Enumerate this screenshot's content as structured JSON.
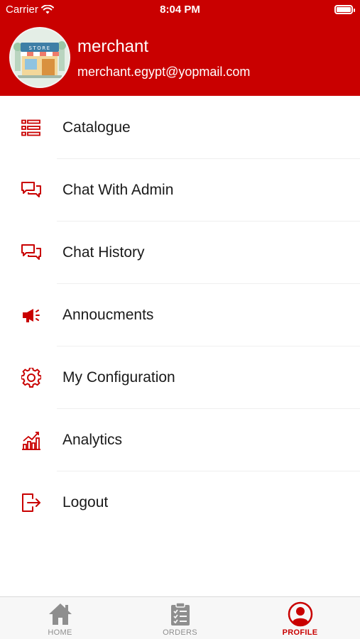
{
  "status_bar": {
    "carrier": "Carrier",
    "time": "8:04 PM"
  },
  "profile": {
    "store_sign": "STORE",
    "name": "merchant",
    "email": "merchant.egypt@yopmail.com"
  },
  "menu": {
    "items": [
      {
        "label": "Catalogue",
        "icon": "list-icon"
      },
      {
        "label": "Chat With Admin",
        "icon": "chat-bubbles-icon"
      },
      {
        "label": "Chat History",
        "icon": "chat-bubbles-icon"
      },
      {
        "label": "Annoucments",
        "icon": "megaphone-icon"
      },
      {
        "label": "My Configuration",
        "icon": "gear-icon"
      },
      {
        "label": "Analytics",
        "icon": "analytics-chart-icon"
      },
      {
        "label": "Logout",
        "icon": "logout-icon"
      }
    ]
  },
  "tabbar": {
    "tabs": [
      {
        "label": "HOME",
        "icon": "home-icon",
        "active": false
      },
      {
        "label": "ORDERS",
        "icon": "clipboard-icon",
        "active": false
      },
      {
        "label": "PROFILE",
        "icon": "user-circle-icon",
        "active": true
      }
    ]
  },
  "colors": {
    "accent": "#c90000",
    "tab_inactive": "#8e8e8e",
    "text": "#1a1a1a"
  }
}
